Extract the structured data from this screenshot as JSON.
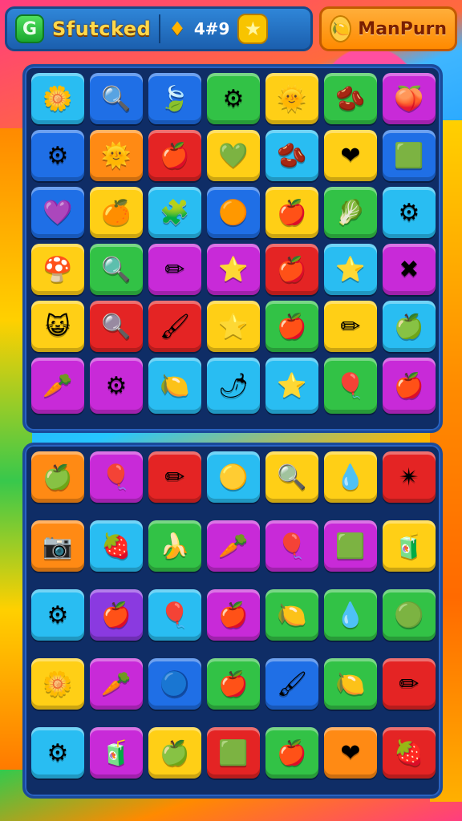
{
  "hud": {
    "title": "Sfutcked",
    "score": "4#9",
    "player_name": "ManPurn",
    "logo_glyph": "G",
    "icons": [
      "logo-icon",
      "drop-icon",
      "star-icon",
      "fruit-icon"
    ]
  },
  "colors": {
    "yellow": "#ffcf16",
    "cyan": "#29bdf2",
    "blue": "#1f6fe6",
    "green": "#32c246",
    "magenta": "#c82ad8",
    "red": "#e42424",
    "orange": "#ff8a14",
    "purple": "#8a3ae0"
  },
  "board1": [
    [
      {
        "c": "cyan",
        "i": "🌼",
        "n": "sun-gem"
      },
      {
        "c": "blue",
        "i": "🔍",
        "n": "magnifier-gem"
      },
      {
        "c": "blue",
        "i": "🍃",
        "n": "leaf-gem"
      },
      {
        "c": "green",
        "i": "⚙",
        "n": "gear-gem"
      },
      {
        "c": "yellow",
        "i": "🌞",
        "n": "sun-gem"
      },
      {
        "c": "green",
        "i": "🫘",
        "n": "bean-gem"
      },
      {
        "c": "magenta",
        "i": "🍑",
        "n": "peach-gem"
      }
    ],
    [
      {
        "c": "blue",
        "i": "⚙",
        "n": "gear-gem"
      },
      {
        "c": "orange",
        "i": "🌞",
        "n": "sun-gem"
      },
      {
        "c": "red",
        "i": "🍎",
        "n": "apple-gem"
      },
      {
        "c": "yellow",
        "i": "💚",
        "n": "leaf-gem"
      },
      {
        "c": "cyan",
        "i": "🫘",
        "n": "bean-gem"
      },
      {
        "c": "yellow",
        "i": "❤",
        "n": "heart-gem"
      },
      {
        "c": "blue",
        "i": "🟩",
        "n": "square-gem"
      }
    ],
    [
      {
        "c": "blue",
        "i": "💜",
        "n": "heart-gem"
      },
      {
        "c": "yellow",
        "i": "🍊",
        "n": "orange-gem"
      },
      {
        "c": "cyan",
        "i": "🧩",
        "n": "puzzle-gem"
      },
      {
        "c": "blue",
        "i": "🟠",
        "n": "orb-gem"
      },
      {
        "c": "yellow",
        "i": "🍎",
        "n": "apple-gem"
      },
      {
        "c": "green",
        "i": "🥬",
        "n": "leaf-gem"
      },
      {
        "c": "cyan",
        "i": "⚙",
        "n": "gear-gem"
      }
    ],
    [
      {
        "c": "yellow",
        "i": "🍄",
        "n": "mushroom-gem"
      },
      {
        "c": "green",
        "i": "🔍",
        "n": "magnifier-gem"
      },
      {
        "c": "magenta",
        "i": "✏",
        "n": "pencil-gem"
      },
      {
        "c": "magenta",
        "i": "⭐",
        "n": "star-gem"
      },
      {
        "c": "red",
        "i": "🍎",
        "n": "apple-gem"
      },
      {
        "c": "cyan",
        "i": "⭐",
        "n": "star-gem"
      },
      {
        "c": "magenta",
        "i": "✖",
        "n": "cross-gem"
      }
    ],
    [
      {
        "c": "yellow",
        "i": "😺",
        "n": "face-gem"
      },
      {
        "c": "red",
        "i": "🔍",
        "n": "magnifier-gem"
      },
      {
        "c": "red",
        "i": "🖌",
        "n": "brush-gem"
      },
      {
        "c": "yellow",
        "i": "⭐",
        "n": "star-gem"
      },
      {
        "c": "green",
        "i": "🍎",
        "n": "apple-gem"
      },
      {
        "c": "yellow",
        "i": "✏",
        "n": "pencil-gem"
      },
      {
        "c": "cyan",
        "i": "🍏",
        "n": "apple-gem"
      }
    ],
    [
      {
        "c": "magenta",
        "i": "🥕",
        "n": "carrot-gem"
      },
      {
        "c": "magenta",
        "i": "⚙",
        "n": "gear-gem"
      },
      {
        "c": "cyan",
        "i": "🍋",
        "n": "lemon-gem"
      },
      {
        "c": "cyan",
        "i": "🌶",
        "n": "pepper-gem"
      },
      {
        "c": "cyan",
        "i": "⭐",
        "n": "star-gem"
      },
      {
        "c": "green",
        "i": "🎈",
        "n": "balloon-gem"
      },
      {
        "c": "magenta",
        "i": "🍎",
        "n": "apple-gem"
      }
    ]
  ],
  "board2": [
    [
      {
        "c": "orange",
        "i": "🍏",
        "n": "apple-gem"
      },
      {
        "c": "magenta",
        "i": "🎈",
        "n": "balloon-gem"
      },
      {
        "c": "red",
        "i": "✏",
        "n": "pencil-gem"
      },
      {
        "c": "cyan",
        "i": "🟡",
        "n": "orb-gem"
      },
      {
        "c": "yellow",
        "i": "🔍",
        "n": "magnifier-gem"
      },
      {
        "c": "yellow",
        "i": "💧",
        "n": "drop-gem"
      },
      {
        "c": "red",
        "i": "✴",
        "n": "sparkle-gem"
      }
    ],
    [
      {
        "c": "orange",
        "i": "📷",
        "n": "camera-gem"
      },
      {
        "c": "cyan",
        "i": "🍓",
        "n": "strawberry-gem"
      },
      {
        "c": "green",
        "i": "🍌",
        "n": "banana-gem"
      },
      {
        "c": "magenta",
        "i": "🥕",
        "n": "carrot-gem"
      },
      {
        "c": "magenta",
        "i": "🎈",
        "n": "balloon-gem"
      },
      {
        "c": "magenta",
        "i": "🟩",
        "n": "cube-gem"
      },
      {
        "c": "yellow",
        "i": "🧃",
        "n": "juice-gem"
      }
    ],
    [
      {
        "c": "cyan",
        "i": "⚙",
        "n": "gear-gem"
      },
      {
        "c": "purple",
        "i": "🍎",
        "n": "apple-gem"
      },
      {
        "c": "cyan",
        "i": "🎈",
        "n": "balloon-gem"
      },
      {
        "c": "magenta",
        "i": "🍎",
        "n": "apple-gem"
      },
      {
        "c": "green",
        "i": "🍋",
        "n": "lemon-gem"
      },
      {
        "c": "green",
        "i": "💧",
        "n": "drop-gem"
      },
      {
        "c": "green",
        "i": "🟢",
        "n": "orb-gem"
      }
    ],
    [
      {
        "c": "yellow",
        "i": "🌼",
        "n": "flower-gem"
      },
      {
        "c": "magenta",
        "i": "🥕",
        "n": "carrot-gem"
      },
      {
        "c": "blue",
        "i": "🔵",
        "n": "orb-gem"
      },
      {
        "c": "green",
        "i": "🍎",
        "n": "apple-gem"
      },
      {
        "c": "blue",
        "i": "🖌",
        "n": "brush-gem"
      },
      {
        "c": "green",
        "i": "🍋",
        "n": "lemon-gem"
      },
      {
        "c": "red",
        "i": "✏",
        "n": "pencil-gem"
      }
    ],
    [
      {
        "c": "cyan",
        "i": "⚙",
        "n": "gear-gem"
      },
      {
        "c": "magenta",
        "i": "🧃",
        "n": "juice-gem"
      },
      {
        "c": "yellow",
        "i": "🍏",
        "n": "apple-gem"
      },
      {
        "c": "red",
        "i": "🟩",
        "n": "square-gem"
      },
      {
        "c": "green",
        "i": "🍎",
        "n": "apple-gem"
      },
      {
        "c": "orange",
        "i": "❤",
        "n": "heart-gem"
      },
      {
        "c": "red",
        "i": "🍓",
        "n": "strawberry-gem"
      }
    ]
  ]
}
